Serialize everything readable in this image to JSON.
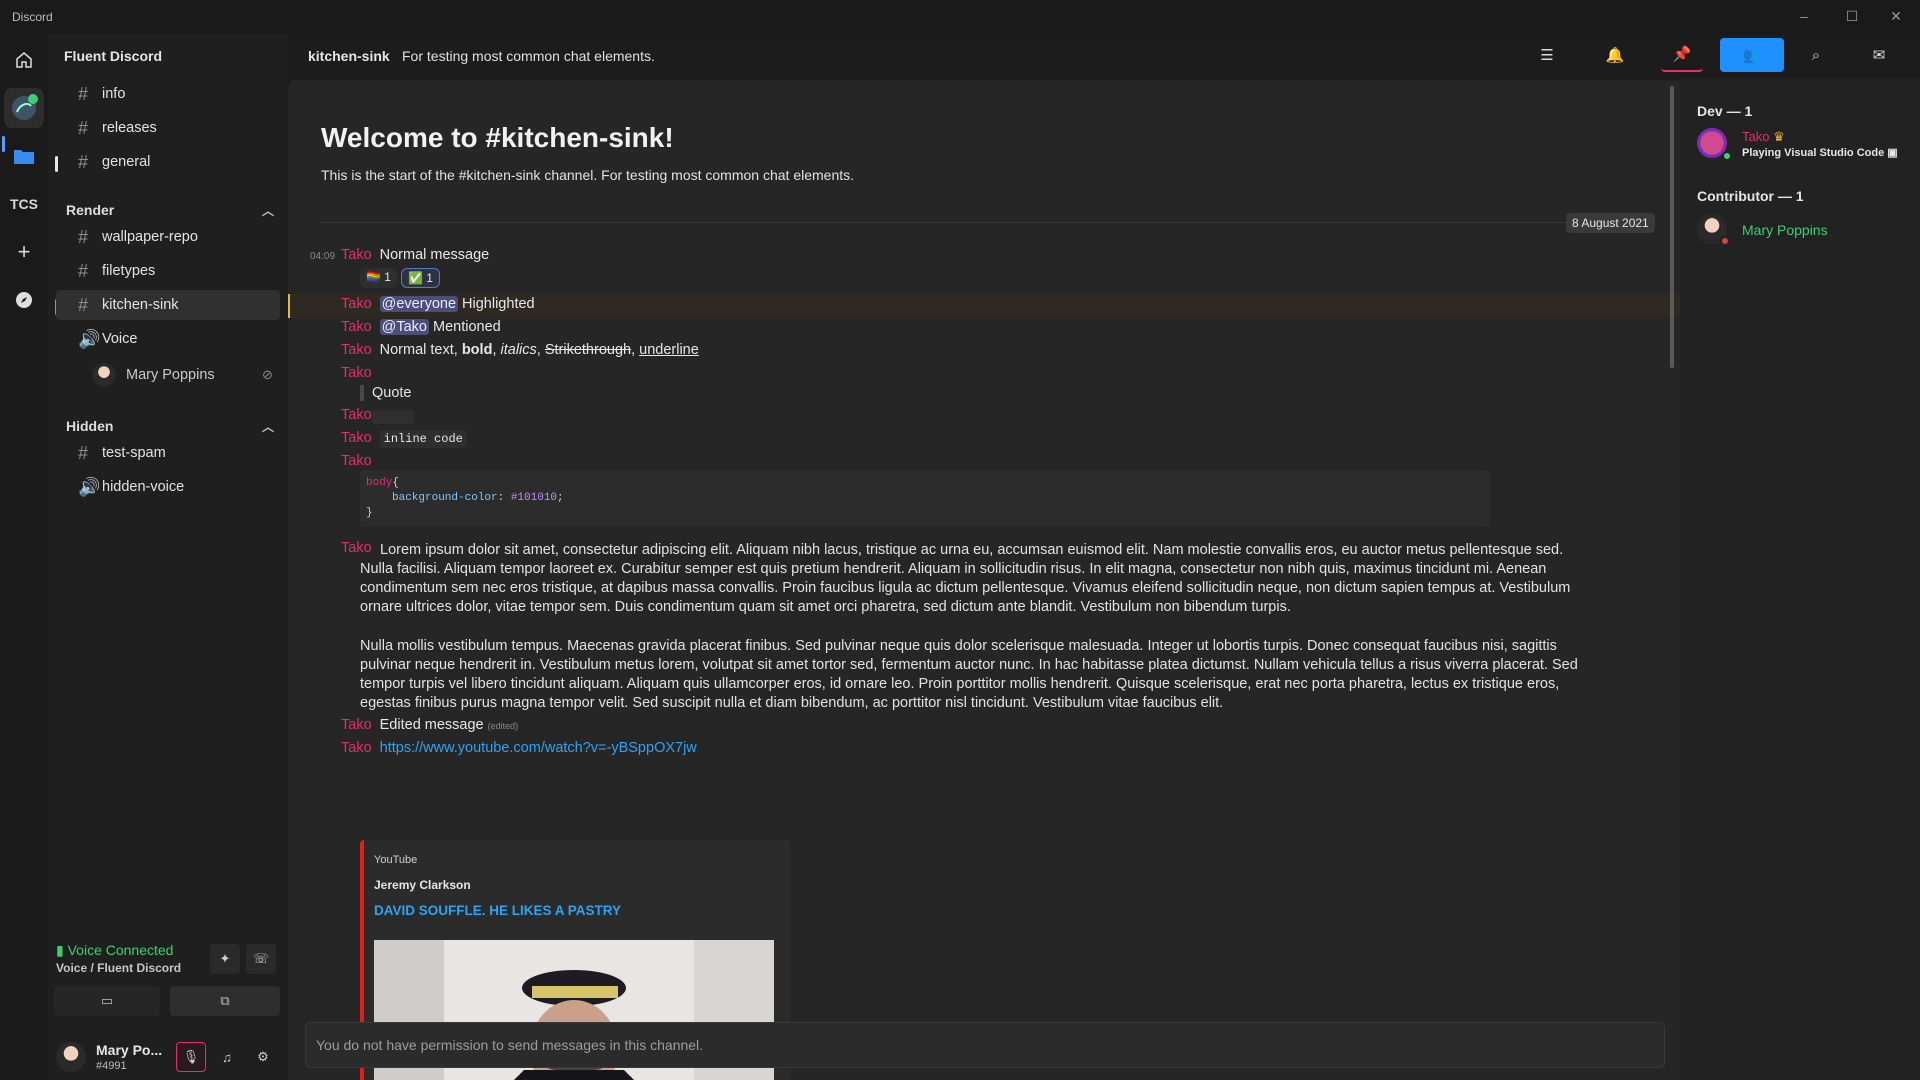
{
  "window": {
    "title": "Discord",
    "controls": [
      "–",
      "☐",
      "✕"
    ]
  },
  "rail": {
    "servers": [
      "home",
      "server-avatar",
      "folder",
      "TCS",
      "add",
      "explore"
    ],
    "tcs_label": "TCS"
  },
  "sidebar": {
    "server_name": "Fluent Discord",
    "top_channels": [
      {
        "name": "info"
      },
      {
        "name": "releases"
      },
      {
        "name": "general"
      }
    ],
    "categories": [
      {
        "name": "Render",
        "channels": [
          {
            "name": "wallpaper-repo"
          },
          {
            "name": "filetypes"
          },
          {
            "name": "kitchen-sink",
            "selected": true
          },
          {
            "name": "Voice",
            "type": "voice"
          }
        ]
      },
      {
        "name": "Hidden",
        "channels": [
          {
            "name": "test-spam"
          },
          {
            "name": "hidden-voice",
            "type": "voice"
          }
        ]
      }
    ],
    "voice_user": "Mary Poppins",
    "voice": {
      "status": "Voice Connected",
      "location": "Voice / Fluent Discord"
    },
    "user": {
      "name": "Mary Po...",
      "tag": "#4991"
    }
  },
  "header": {
    "channel": "kitchen-sink",
    "topic": "For testing most common chat elements."
  },
  "chat": {
    "welcome_title": "Welcome to #kitchen-sink!",
    "welcome_sub": "This is the start of the #kitchen-sink channel. For testing most common chat elements.",
    "date": "8 August 2021",
    "time": "04:09",
    "author": "Tako",
    "m1": "Normal message",
    "reactions": [
      {
        "emoji": "🏳️‍🌈",
        "count": "1"
      },
      {
        "emoji": "✅",
        "count": "1"
      }
    ],
    "everyone": "@everyone",
    "highlighted": "Highlighted",
    "tako_mention": "@Tako",
    "mentioned": "Mentioned",
    "fmt": {
      "normal": "Normal text, ",
      "bold": "bold",
      "italics": "italics",
      "strike": "Strikethrough",
      "underline": "underline",
      "sep": ", "
    },
    "quote": "Quote",
    "inline_code": "inline code",
    "code": {
      "sel": "body",
      "open": "{",
      "prop": "background-color",
      "colon": ": ",
      "val": "#101010",
      "semi": ";",
      "close": "}"
    },
    "lorem1": "Lorem ipsum dolor sit amet, consectetur adipiscing elit. Aliquam nibh lacus, tristique ac urna eu, accumsan euismod elit. Nam molestie convallis eros, eu auctor metus pellentesque sed. Nulla facilisi. Aliquam tempor laoreet ex. Curabitur semper est quis pretium hendrerit. Aliquam in sollicitudin risus. In elit magna, consectetur non nibh quis, maximus tincidunt mi. Aenean condimentum sem nec eros tristique, at dapibus massa convallis. Proin faucibus ligula ac dictum pellentesque. Vivamus eleifend sollicitudin neque, non dictum sapien tempus at. Vestibulum ornare ultrices dolor, vitae tempor sem. Duis condimentum quam sit amet orci pharetra, sed dictum ante blandit. Vestibulum non bibendum turpis.",
    "lorem2": "Nulla mollis vestibulum tempus. Maecenas gravida placerat finibus. Sed pulvinar neque quis dolor scelerisque malesuada. Integer ut lobortis turpis. Donec consequat faucibus nisi, sagittis pulvinar neque hendrerit in. Vestibulum metus lorem, volutpat sit amet tortor sed, fermentum auctor nunc. In hac habitasse platea dictumst. Nullam vehicula tellus a risus viverra placerat. Sed tempor turpis vel libero tincidunt aliquam. Aliquam quis ullamcorper eros, id ornare leo. Proin porttitor mollis hendrerit. Quisque scelerisque, erat nec porta pharetra, lectus ex tristique eros, egestas finibus purus magna tempor velit. Sed suscipit nulla et diam bibendum, ac porttitor nisl tincidunt. Vestibulum vitae faucibus elit.",
    "edited": "Edited message",
    "edited_tag": "(edited)",
    "link": "https://www.youtube.com/watch?v=-yBSppOX7jw",
    "embed": {
      "provider": "YouTube",
      "author": "Jeremy Clarkson",
      "title": "DAVID SOUFFLE. HE LIKES A PASTRY"
    },
    "composer_placeholder": "You do not have permission to send messages in this channel."
  },
  "members": {
    "groups": [
      {
        "title": "Dev — 1",
        "member": "Tako",
        "activity": "Playing Visual Studio Code",
        "color": "#e0306e"
      },
      {
        "title": "Contributor — 1",
        "member": "Mary Poppins",
        "color": "#3fcf70"
      }
    ]
  },
  "colors": {
    "accent": "#1e90ff",
    "author": "#e0306e",
    "online": "#3fcf70",
    "link": "#2ea3ee",
    "embed_border": "#e0201f"
  }
}
